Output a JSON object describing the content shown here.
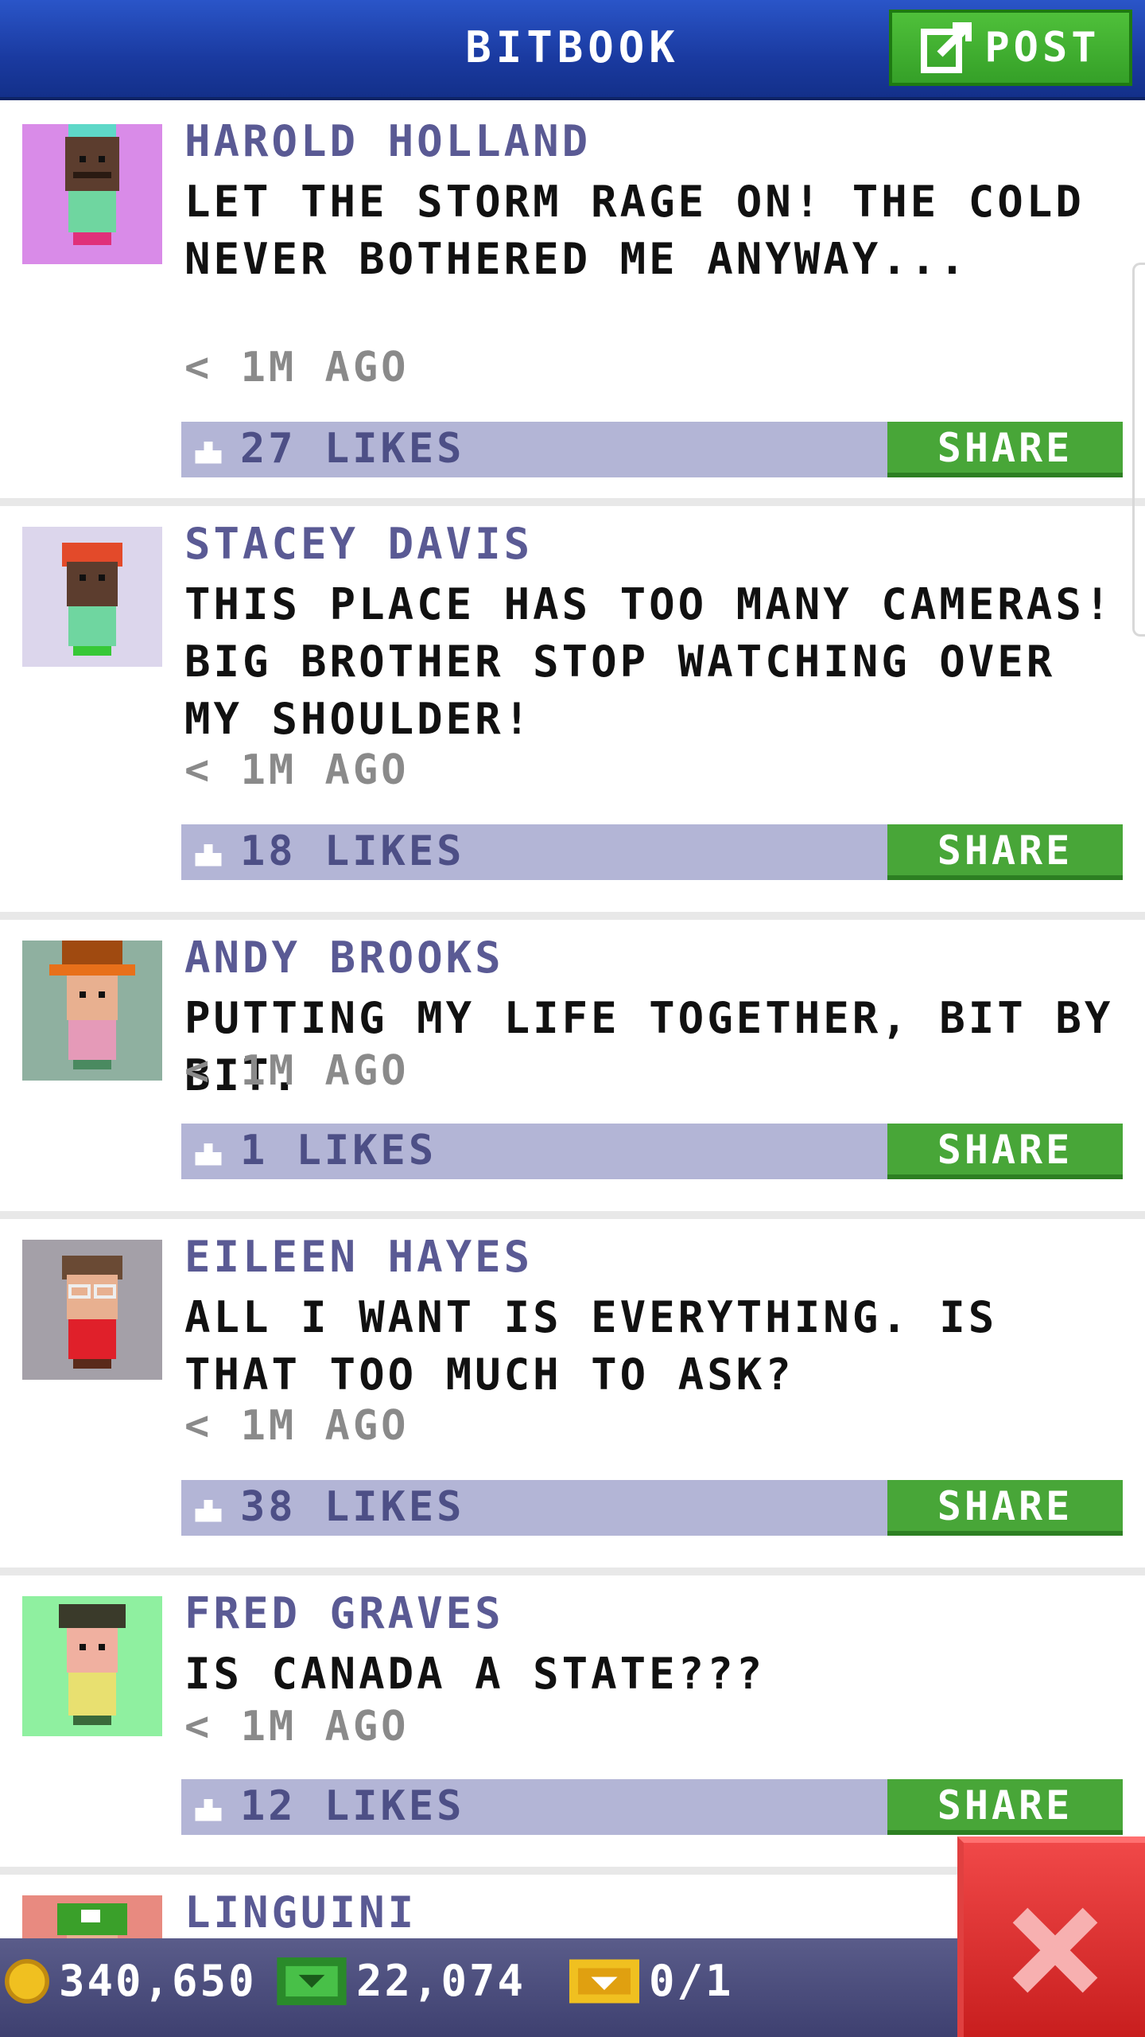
{
  "header": {
    "title": "BITBOOK",
    "post_label": "POST"
  },
  "posts": [
    {
      "author": "HAROLD HOLLAND",
      "message": "LET THE STORM RAGE ON! THE COLD NEVER BOTHERED ME ANYWAY...",
      "time": "< 1M AGO",
      "likes": "27 LIKES",
      "share": "SHARE",
      "avatar_bg": "#d98be8"
    },
    {
      "author": "STACEY DAVIS",
      "message": "THIS PLACE HAS TOO MANY CAMERAS! BIG BROTHER STOP WATCHING OVER MY SHOULDER!",
      "time": "< 1M AGO",
      "likes": "18 LIKES",
      "share": "SHARE",
      "avatar_bg": "#dcd6ec"
    },
    {
      "author": "ANDY BROOKS",
      "message": "PUTTING MY LIFE TOGETHER, BIT BY BIT.",
      "time": "< 1M AGO",
      "likes": "1 LIKES",
      "share": "SHARE",
      "avatar_bg": "#8fb0a0"
    },
    {
      "author": "EILEEN HAYES",
      "message": "ALL I WANT IS EVERYTHING. IS THAT TOO MUCH TO ASK?",
      "time": "< 1M AGO",
      "likes": "38 LIKES",
      "share": "SHARE",
      "avatar_bg": "#a4a0a8"
    },
    {
      "author": "FRED GRAVES",
      "message": "IS CANADA A STATE???",
      "time": "< 1M AGO",
      "likes": "12 LIKES",
      "share": "SHARE",
      "avatar_bg": "#8ff0a0"
    },
    {
      "author": "LINGUINI",
      "message": "",
      "time": "",
      "likes": "",
      "share": "",
      "avatar_bg": "#e88a80"
    }
  ],
  "bottom_bar": {
    "coins": "340,650",
    "bux": "22,074",
    "tickets": "0/1"
  },
  "colors": {
    "header": "#1a3aa0",
    "share": "#48a638",
    "like_bar": "#b3b5d6",
    "author": "#5a5a94",
    "close": "#d82828"
  },
  "icons": {
    "post": "edit-icon",
    "like": "thumbs-up-icon",
    "close": "close-icon",
    "coin": "coin-icon",
    "bux": "bux-icon",
    "ticket": "ticket-icon"
  }
}
